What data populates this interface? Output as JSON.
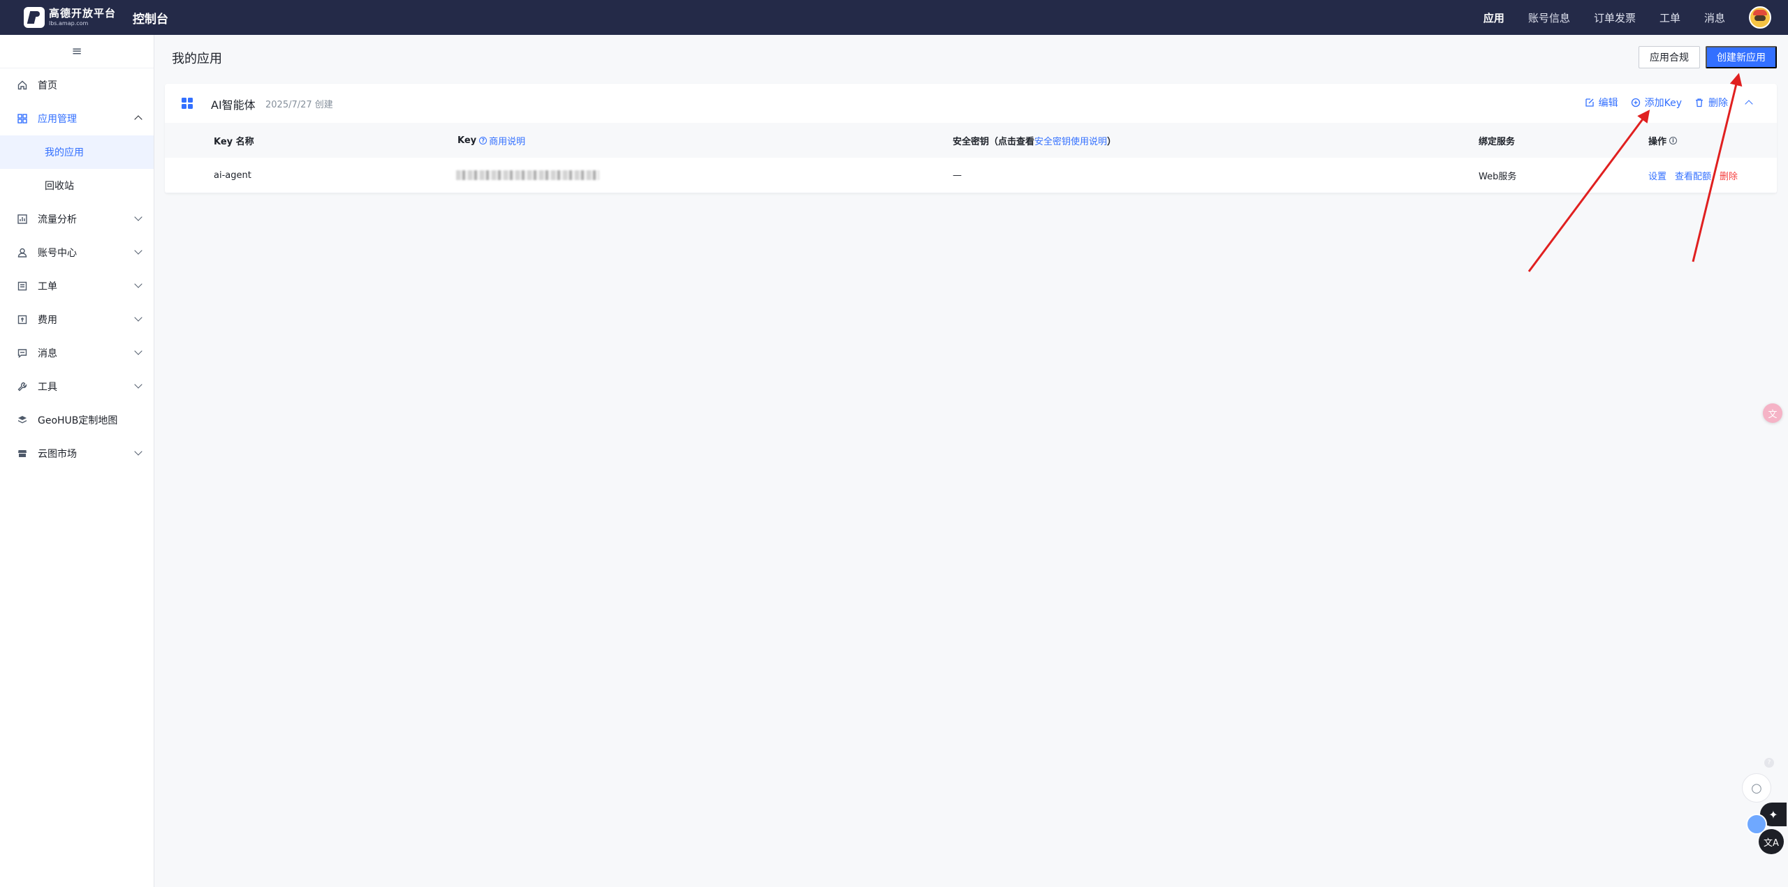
{
  "header": {
    "logo_text": "高德开放平台",
    "logo_sub": "lbs.amap.com",
    "console_title": "控制台",
    "nav": [
      "应用",
      "账号信息",
      "订单发票",
      "工单",
      "消息"
    ],
    "active_nav": "应用"
  },
  "sidebar": {
    "items": [
      {
        "label": "首页",
        "icon": "home-icon"
      },
      {
        "label": "应用管理",
        "icon": "grid-icon",
        "children": [
          "我的应用",
          "回收站"
        ],
        "selected_child": "我的应用"
      },
      {
        "label": "流量分析",
        "icon": "chart-icon"
      },
      {
        "label": "账号中心",
        "icon": "user-icon"
      },
      {
        "label": "工单",
        "icon": "ticket-icon"
      },
      {
        "label": "费用",
        "icon": "fee-icon"
      },
      {
        "label": "消息",
        "icon": "message-icon"
      },
      {
        "label": "工具",
        "icon": "wrench-icon"
      },
      {
        "label": "GeoHUB定制地图",
        "icon": "layers-icon"
      },
      {
        "label": "云图市场",
        "icon": "store-icon"
      }
    ]
  },
  "main": {
    "title": "我的应用",
    "compliance_button": "应用合规",
    "create_button": "创建新应用",
    "app": {
      "name": "AI智能体",
      "created": "2025/7/27 创建",
      "actions": {
        "edit": "编辑",
        "add_key": "添加Key",
        "delete": "删除"
      },
      "table": {
        "headers": {
          "key_name": "Key 名称",
          "key": "Key",
          "key_link": "商用说明",
          "secret": "安全密钥（点击查看",
          "secret_link": "安全密钥使用说明",
          "secret_close": "）",
          "service": "绑定服务",
          "ops": "操作"
        },
        "rows": [
          {
            "key_name": "ai-agent",
            "secret": "—",
            "service": "Web服务",
            "ops": [
              "设置",
              "查看配额",
              "删除"
            ]
          }
        ]
      }
    }
  },
  "colors": {
    "header_bg": "#242a48",
    "accent": "#3370ff",
    "danger": "#f53f3f",
    "arrow": "#e02020"
  }
}
